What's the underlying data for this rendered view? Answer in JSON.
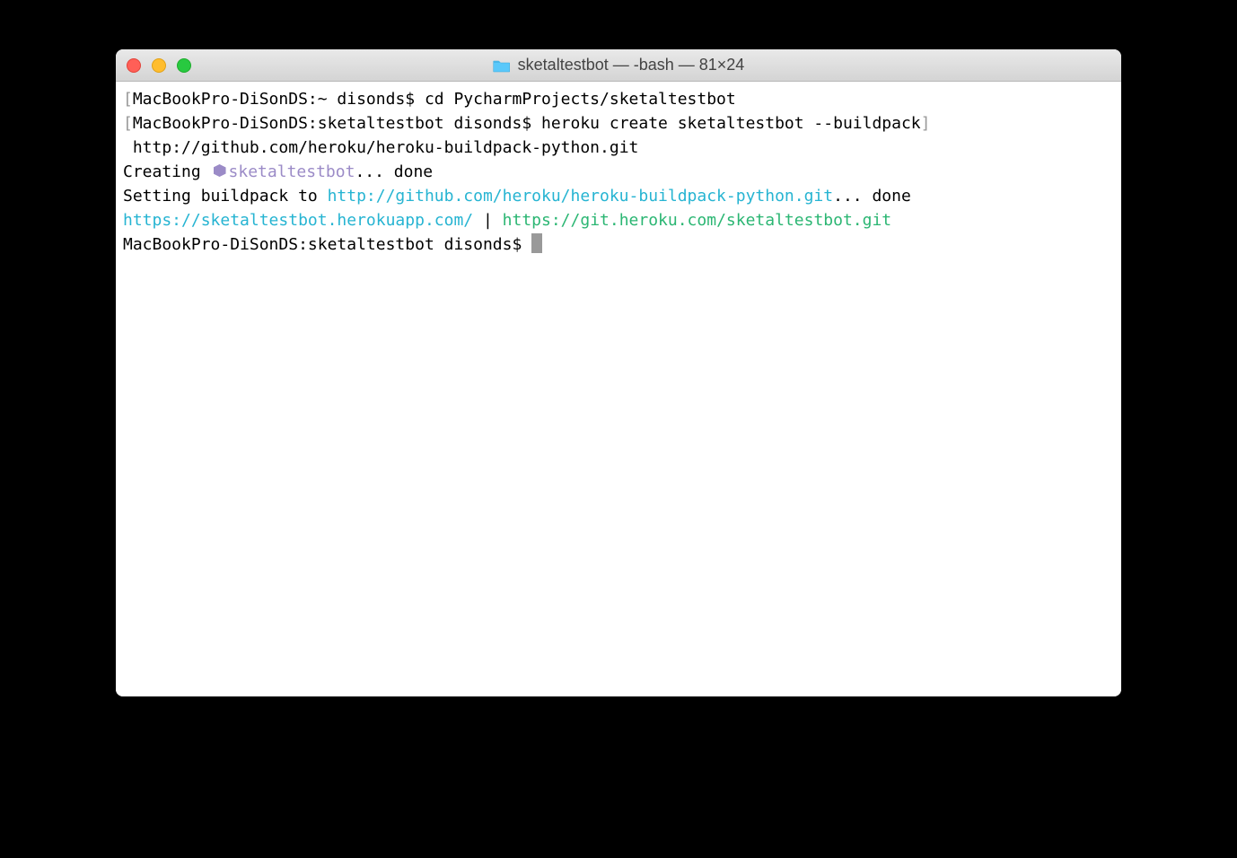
{
  "window": {
    "title": "sketaltestbot — -bash — 81×24"
  },
  "terminal": {
    "line1_bracket_open": "[",
    "line1_prompt": "MacBookPro-DiSonDS:~ disonds$ ",
    "line1_cmd": "cd PycharmProjects/sketaltestbot",
    "line1_bracket_close": "]",
    "line2_bracket_open": "[",
    "line2_prompt": "MacBookPro-DiSonDS:sketaltestbot disonds$ ",
    "line2_cmd": "heroku create sketaltestbot --buildpack",
    "line2_bracket_close": "]",
    "line3": " http://github.com/heroku/heroku-buildpack-python.git",
    "line4_a": "Creating ",
    "line4_b": "sketaltestbot",
    "line4_c": "... done",
    "line5_a": "Setting buildpack to ",
    "line5_b": "http://github.com/heroku/heroku-buildpack-python.git",
    "line5_c": "... done",
    "line6_a": "https://sketaltestbot.herokuapp.com/",
    "line6_b": " | ",
    "line6_c": "https://git.heroku.com/sketaltestbot.git",
    "line7_prompt": "MacBookPro-DiSonDS:sketaltestbot disonds$ "
  }
}
